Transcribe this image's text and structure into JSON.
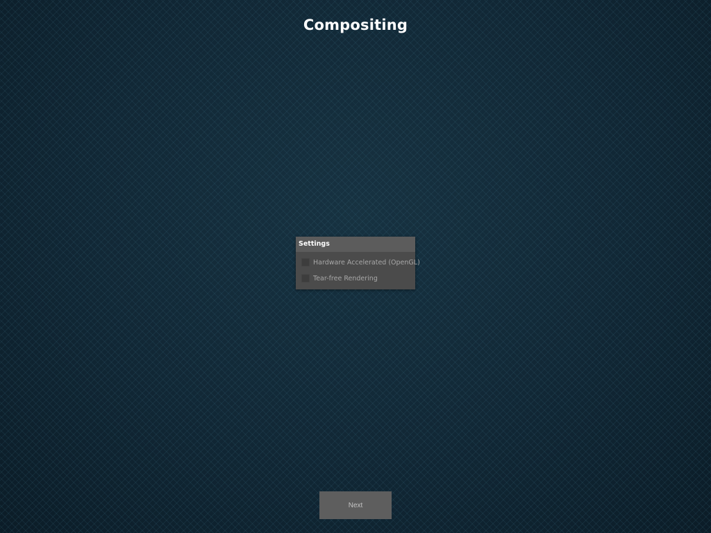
{
  "page": {
    "title": "Compositing"
  },
  "settings": {
    "header": "Settings",
    "options": [
      {
        "label": "Hardware Accelerated (OpenGL)",
        "checked": false
      },
      {
        "label": "Tear-free Rendering",
        "checked": false
      }
    ]
  },
  "footer": {
    "next_label": "Next"
  },
  "colors": {
    "background": "#0f2330",
    "panel": "#4b4b4b",
    "panel_header": "#5c5c5c",
    "button": "#5e5e5e"
  }
}
